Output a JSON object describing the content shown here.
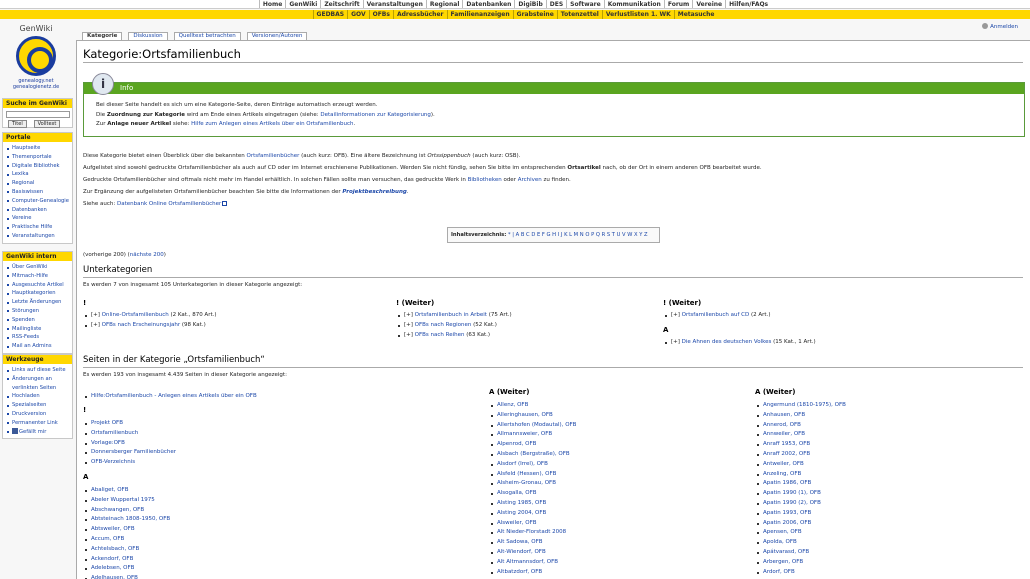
{
  "topnav1": [
    "Home",
    "GenWiki",
    "Zeitschrift",
    "Veranstaltungen",
    "Regional",
    "Datenbanken",
    "DigiBib",
    "DES",
    "Software",
    "Kommunikation",
    "Forum",
    "Vereine",
    "Hilfen/FAQs"
  ],
  "topnav2": [
    "GEDBAS",
    "GOV",
    "OFBs",
    "Adressbücher",
    "Familienanzeigen",
    "Grabsteine",
    "Totenzettel",
    "Verlustlisten 1. WK",
    "Metasuche"
  ],
  "user_login": "Anmelden",
  "logo": {
    "title": "GenWiki",
    "line1": "genealogy.net",
    "line2": "genealogienetz.de"
  },
  "search": {
    "title": "Suche im GenWiki",
    "btn_title": "Titel",
    "btn_full": "Volltext"
  },
  "portal": {
    "title": "Portale",
    "items": [
      "Hauptseite",
      "Themenportale",
      "Digitale Bibliothek",
      "Lexika",
      "Regional",
      "Basiswissen",
      "Computer-Genealogie",
      "Datenbanken",
      "Vereine",
      "Praktische Hilfe",
      "Veranstaltungen"
    ]
  },
  "intern": {
    "title": "GenWiki intern",
    "items": [
      "Über GenWiki",
      "Mitmach-Hilfe",
      "Ausgesuchte Artikel",
      "Hauptkategorien",
      "Letzte Änderungen",
      "Störungen",
      "Spenden",
      "Mailingliste",
      "RSS-Feeds",
      "Mail an Admins"
    ]
  },
  "tools": {
    "title": "Werkzeuge",
    "items": [
      "Links auf diese Seite",
      "Änderungen an verlinkten Seiten",
      "Hochladen",
      "Spezialseiten",
      "Druckversion",
      "Permanenter Link",
      "Gefällt mir"
    ]
  },
  "tabs": [
    "Kategorie",
    "Diskussion",
    "Quelltext betrachten",
    "Versionen/Autoren"
  ],
  "page_title": "Kategorie:Ortsfamilienbuch",
  "info": {
    "header": "Info",
    "icon": "i",
    "line1": "Bei dieser Seite handelt es sich um eine Kategorie-Seite, deren Einträge automatisch erzeugt werden.",
    "line2_a": "Die ",
    "line2_b": "Zuordnung zur Kategorie",
    "line2_c": " wird am Ende eines Artikels eingetragen (siehe: ",
    "line2_link": "Detailinformationen zur Kategorisierung",
    "line2_d": ").",
    "line3_a": "Zur ",
    "line3_b": "Anlage neuer Artikel",
    "line3_c": " siehe: ",
    "line3_link": "Hilfe zum Anlegen eines Artikels über ein Ortsfamilienbuch",
    "line3_d": "."
  },
  "p1": {
    "a": "Diese Kategorie bietet einen Überblick über die bekannten ",
    "link": "Ortsfamilienbücher",
    "b": " (auch kurz: OFB). Eine ältere Bezeichnung ist ",
    "i": "Ortssippenbuch",
    "c": " (auch kurz: OSB)."
  },
  "p2": {
    "a": "Aufgelistet sind sowohl gedruckte Ortsfamilienbücher als auch auf CD oder im Internet erschienene Publikationen. Werden Sie nicht fündig, sehen Sie bitte im entsprechenden ",
    "b": "Ortsartikel",
    "c": " nach, ob der Ort in einem anderen OFB bearbeitet wurde."
  },
  "p3": {
    "a": "Gedruckte Ortsfamilienbücher sind oftmals nicht mehr im Handel erhältlich. In solchen Fällen sollte man versuchen, das gedruckte Werk in ",
    "link1": "Bibliotheken",
    "b": " oder ",
    "link2": "Archiven",
    "c": " zu finden."
  },
  "p4": {
    "a": "Zur Ergänzung der aufgelisteten Ortsfamilienbücher beachten Sie bitte die Informationen der ",
    "link": "Projektbeschreibung",
    "b": "."
  },
  "p5": {
    "a": "Siehe auch: ",
    "link": "Datenbank Online Ortsfamilienbücher"
  },
  "toc": {
    "label": "Inhaltsverzeichnis:",
    "letters": "*  |  A B C D E F G H I J K L M N O P Q R S T U V W X Y Z"
  },
  "nav": {
    "a": "(vorherige 200) (",
    "link": "nächste 200",
    "b": ")"
  },
  "sub": {
    "heading": "Unterkategorien",
    "count": "Es werden 7 von insgesamt 105 Unterkategorien in dieser Kategorie angezeigt:",
    "col1_head": "!",
    "col1": [
      [
        "[+] ",
        "Online-Ortsfamilienbuch",
        " (2 Kat., 870 Art.)"
      ],
      [
        "[+] ",
        "OFBs nach Erscheinungsjahr",
        " (98 Kat.)"
      ]
    ],
    "col2_head": "! (Weiter)",
    "col2": [
      [
        "[+] ",
        "Ortsfamilienbuch in Arbeit",
        " (75 Art.)"
      ],
      [
        "[+] ",
        "OFBs nach Regionen",
        " (52 Kat.)"
      ],
      [
        "[+] ",
        "OFBs nach Reihen",
        " (63 Kat.)"
      ]
    ],
    "col3_head": "! (Weiter)",
    "col3": [
      [
        "[+] ",
        "Ortsfamilienbuch auf CD",
        " (2 Art.)"
      ]
    ],
    "col3_head2": "A",
    "col3b": [
      [
        "[+] ",
        "Die Ahnen des deutschen Volkes",
        " (15 Kat., 1 Art.)"
      ]
    ]
  },
  "pages": {
    "heading": "Seiten in der Kategorie „Ortsfamilienbuch“",
    "count": "Es werden 193 von insgesamt 4.439 Seiten in dieser Kategorie angezeigt:",
    "col1_top": [
      "Hilfe:Ortsfamilienbuch - Anlegen eines Artikels über ein OFB"
    ],
    "col1_head1": "!",
    "col1_ex": [
      "Projekt OFB",
      "Ortsfamilienbuch",
      "Vorlage:OFB",
      "Donnersberger Familienbücher",
      "OFB-Verzeichnis"
    ],
    "col1_head2": "A",
    "col1_a": [
      "Abaliget, OFB",
      "Abeler Wuppertal 1975",
      "Abschwangen, OFB",
      "Abtsteinach 1808-1950, OFB",
      "Abtsweiler, OFB",
      "Accum, OFB",
      "Achtelsbach, OFB",
      "Ackendorf, OFB",
      "Adelebsen, OFB",
      "Adelhausen, OFB"
    ],
    "col2_head": "A (Weiter)",
    "col2": [
      "Allenz, OFB",
      "Alleringhausen, OFB",
      "Allertshofen (Modautal), OFB",
      "Allmannsweier, OFB",
      "Alpenrod, OFB",
      "Alsbach (Bergstraße), OFB",
      "Alsdorf (Irrel), OFB",
      "Alsfeld (Hessen), OFB",
      "Alsheim-Gronau, OFB",
      "Alsogalla, OFB",
      "Alsting 1985, OFB",
      "Alsting 2004, OFB",
      "Alsweiler, OFB",
      "Alt Nieder-Florstadt 2008",
      "Alt Sadowa, OFB",
      "Alt-Wiendorf, OFB",
      "Alt Altmannsdorf, OFB",
      "Altbatzdorf, OFB"
    ],
    "col3_head": "A (Weiter)",
    "col3": [
      "Angermund (1810-1975), OFB",
      "Anhausen, OFB",
      "Annerod, OFB",
      "Annweiler, OFB",
      "Anraff 1953, OFB",
      "Anraff 2002, OFB",
      "Antweiler, OFB",
      "Anzeling, OFB",
      "Apatin 1986, OFB",
      "Apatin 1990 (1), OFB",
      "Apatin 1990 (2), OFB",
      "Apatin 1993, OFB",
      "Apatin 2006, OFB",
      "Apensen, OFB",
      "Apolda, OFB",
      "Apátvarasd, OFB",
      "Arbergen, OFB",
      "Ardorf, OFB"
    ]
  }
}
